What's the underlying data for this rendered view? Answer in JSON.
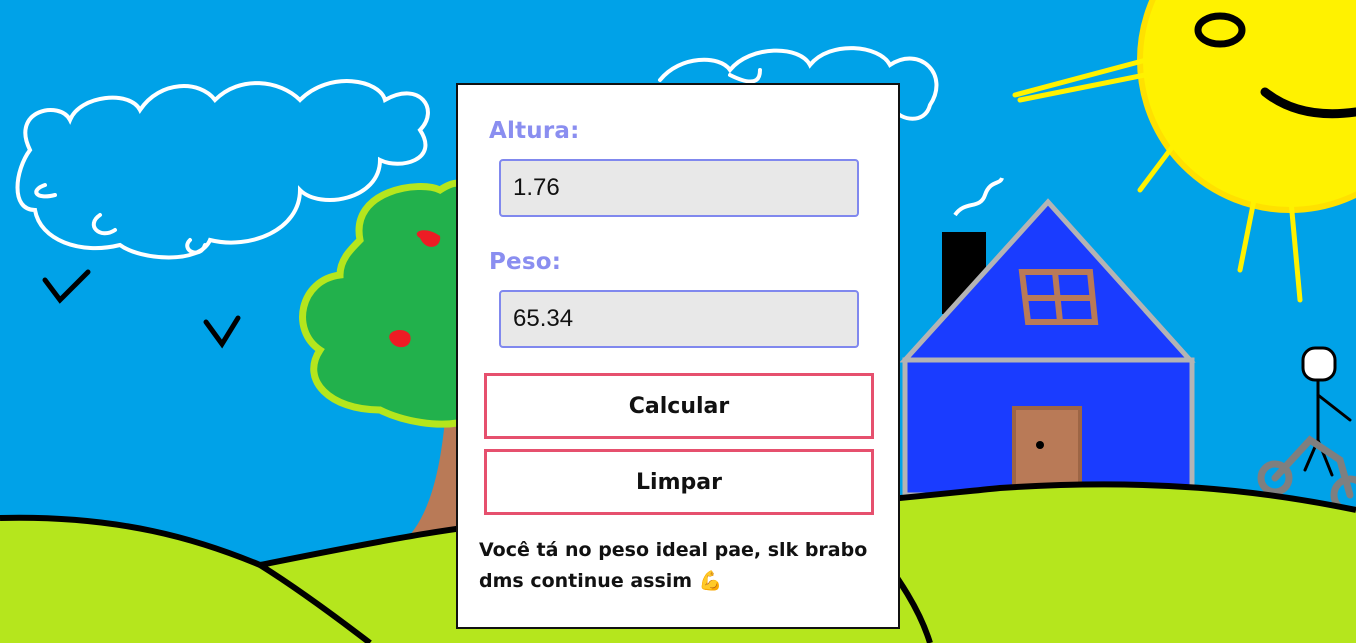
{
  "form": {
    "height_label": "Altura:",
    "height_value": "1.76",
    "weight_label": "Peso:",
    "weight_value": "65.34",
    "calculate_label": "Calcular",
    "clear_label": "Limpar",
    "result_text": "Você tá no peso ideal pae, slk brabo dms continue assim 💪"
  },
  "colors": {
    "sky": "#00a2e8",
    "grass": "#b5e61d",
    "label": "#8a8ef0",
    "input_border": "#8088ee",
    "button_border": "#e6506e",
    "house": "#1a3cff",
    "sun": "#fff200"
  }
}
